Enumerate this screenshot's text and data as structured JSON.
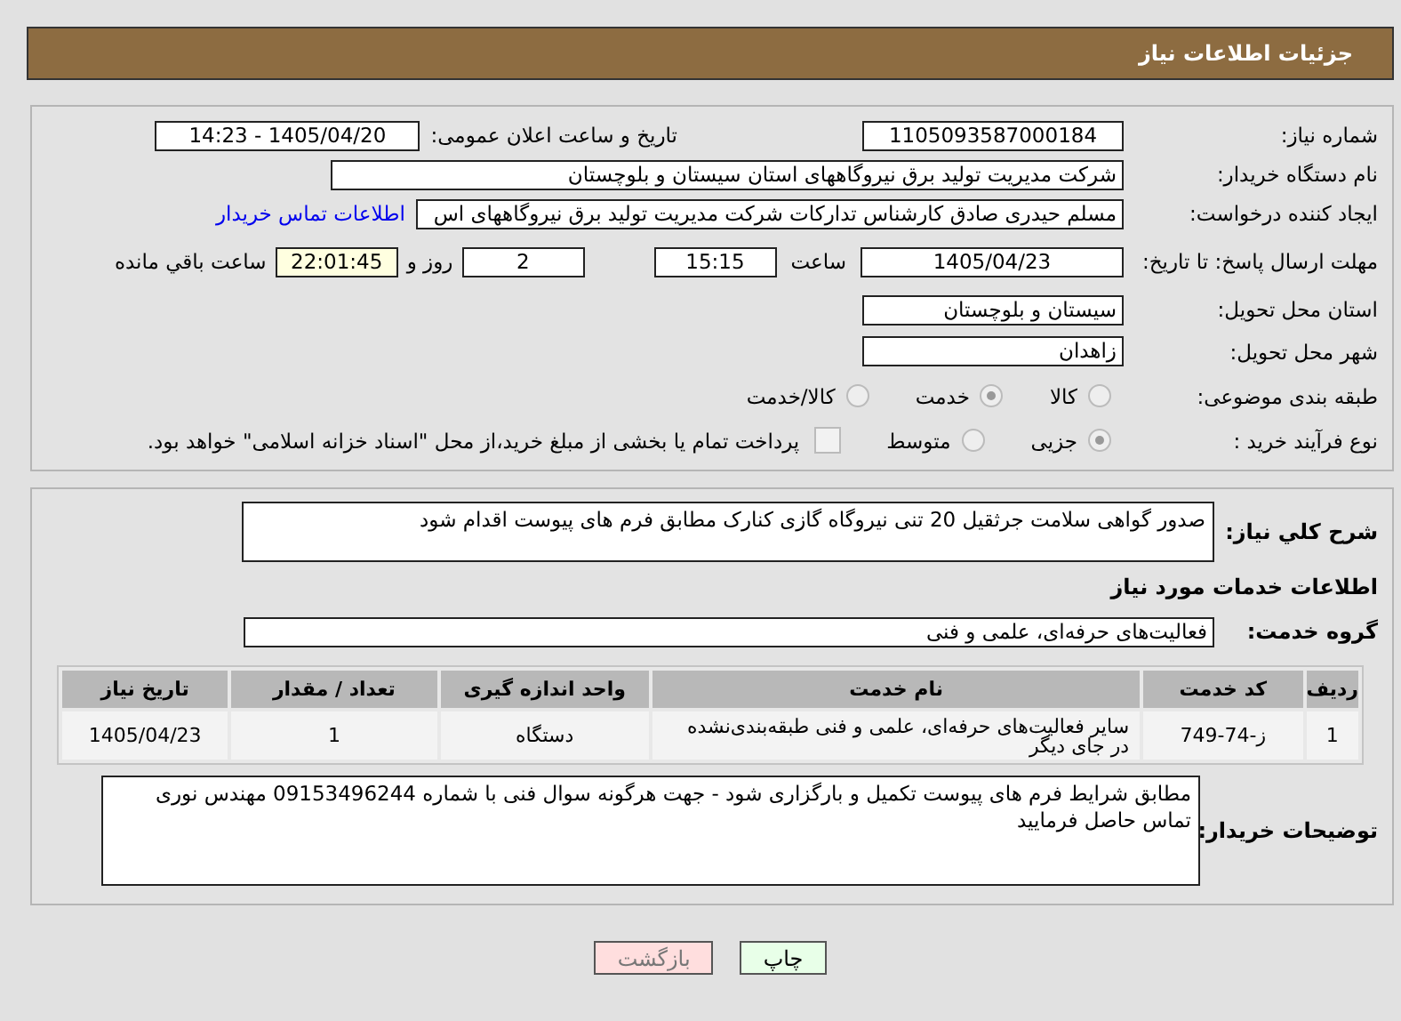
{
  "header": {
    "title": "جزئیات اطلاعات نیاز"
  },
  "need_number": {
    "label": "شماره نیاز:",
    "value": "1105093587000184"
  },
  "announce": {
    "label": "تاریخ و ساعت اعلان عمومی:",
    "value": "1405/04/20 - 14:23"
  },
  "buyer": {
    "label": "نام دستگاه خریدار:",
    "value": "شرکت مدیریت تولید برق نیروگاههای استان سیستان و بلوچستان"
  },
  "creator": {
    "label": "ایجاد کننده درخواست:",
    "value": "مسلم حیدری صادق کارشناس تدارکات شرکت مدیریت تولید برق نیروگاههای اس",
    "link": "اطلاعات تماس خریدار"
  },
  "deadline": {
    "label": "مهلت ارسال پاسخ: تا تاریخ:",
    "date": "1405/04/23",
    "time_label": "ساعت",
    "time": "15:15",
    "days": "2",
    "days_label": "روز و",
    "remaining": "22:01:45",
    "remaining_label": "ساعت باقي مانده"
  },
  "province": {
    "label": "استان محل تحویل:",
    "value": "سیستان و بلوچستان"
  },
  "city": {
    "label": "شهر محل تحویل:",
    "value": "زاهدان"
  },
  "category": {
    "label": "طبقه بندی موضوعی:",
    "options": [
      {
        "label": "کالا",
        "selected": false
      },
      {
        "label": "خدمت",
        "selected": true
      },
      {
        "label": "کالا/خدمت",
        "selected": false
      }
    ]
  },
  "process": {
    "label": "نوع فرآیند خرید :",
    "options": [
      {
        "label": "جزیی",
        "selected": true
      },
      {
        "label": "متوسط",
        "selected": false
      }
    ],
    "payment": {
      "checked": false,
      "text": "پرداخت تمام یا بخشی از مبلغ خرید،از محل \"اسناد خزانه اسلامی\" خواهد بود."
    }
  },
  "description": {
    "label": "شرح کلي نیاز:",
    "value": "صدور گواهی سلامت  جرثقیل 20 تنی نیروگاه گازی کنارک  مطابق فرم های پیوست اقدام شود"
  },
  "services_title": "اطلاعات خدمات مورد نیاز",
  "service_group": {
    "label": "گروه خدمت:",
    "value": "فعالیت‌های حرفه‌ای، علمی و فنی"
  },
  "table": {
    "columns": [
      "ردیف",
      "کد خدمت",
      "نام خدمت",
      "واحد اندازه گیری",
      "تعداد / مقدار",
      "تاریخ نیاز"
    ],
    "rows": [
      [
        "1",
        "ز-74-749",
        "سایر فعالیت‌های حرفه‌ای، علمی و فنی طبقه‌بندی‌نشده در جای دیگر",
        "دستگاه",
        "1",
        "1405/04/23"
      ]
    ]
  },
  "buyer_notes": {
    "label": "توضیحات خریدار:",
    "value": "مطابق شرایط فرم های پیوست تکمیل و بارگزاری شود - جهت هرگونه سوال فنی با شماره 09153496244 مهندس نوری تماس حاصل فرمایید"
  },
  "buttons": [
    {
      "label": "چاپ",
      "kind": "print"
    },
    {
      "label": "بازگشت",
      "kind": "back"
    }
  ]
}
